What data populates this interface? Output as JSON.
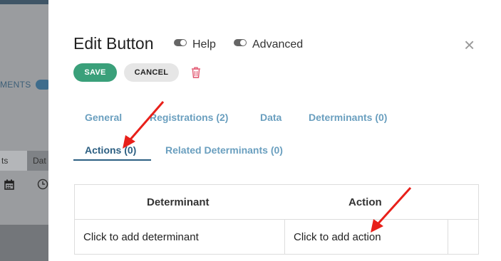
{
  "background": {
    "section_label": "MENTS",
    "tabs": [
      "ts",
      "Dat"
    ],
    "icons": [
      "calendar-icon",
      "clock-icon"
    ]
  },
  "modal": {
    "title": "Edit Button",
    "toggles": [
      {
        "label": "Help",
        "on": false
      },
      {
        "label": "Advanced",
        "on": false
      }
    ],
    "close_icon": "×",
    "buttons": {
      "save": "SAVE",
      "cancel": "CANCEL"
    },
    "tabs": [
      {
        "label": "General",
        "active": false
      },
      {
        "label": "Registrations (2)",
        "active": false
      },
      {
        "label": "Data",
        "active": false
      },
      {
        "label": "Determinants (0)",
        "active": false
      },
      {
        "label": "Actions (0)",
        "active": true
      },
      {
        "label": "Related Determinants (0)",
        "active": false
      }
    ],
    "table": {
      "headers": [
        "Determinant",
        "Action"
      ],
      "rows": [
        [
          "Click to add determinant",
          "Click to add action"
        ]
      ]
    }
  },
  "colors": {
    "accent": "#3aa07a",
    "tab": "#6a9fbf",
    "tab_active": "#2c5f82",
    "delete": "#e0506a",
    "arrow": "#e8201a"
  }
}
